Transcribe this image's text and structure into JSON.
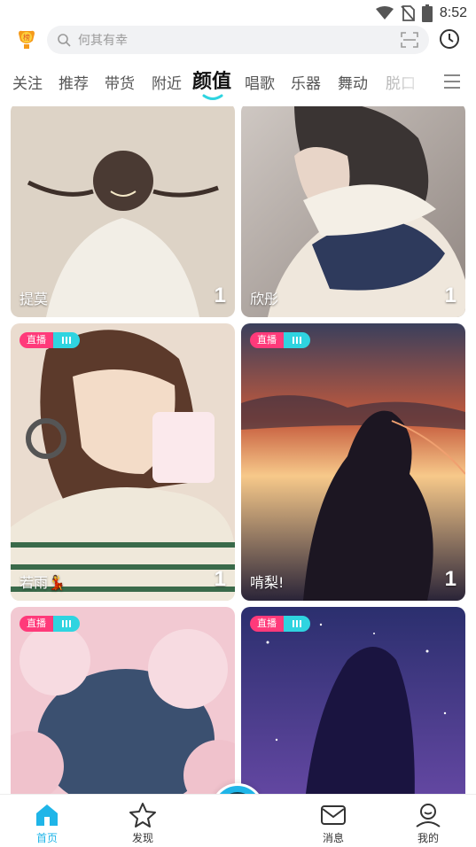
{
  "status_bar": {
    "time": "8:52",
    "icons": [
      "wifi-icon",
      "no-sim-icon",
      "battery-icon"
    ]
  },
  "header": {
    "logo_icon": "ranking-trophy-icon",
    "search": {
      "placeholder": "何其有幸",
      "icon": "search-icon",
      "scan_icon": "scan-icon"
    },
    "history_icon": "clock-icon"
  },
  "tabs": {
    "items": [
      {
        "label": "关注"
      },
      {
        "label": "推荐"
      },
      {
        "label": "带货"
      },
      {
        "label": "附近"
      },
      {
        "label": "颜值",
        "active": true
      },
      {
        "label": "唱歌"
      },
      {
        "label": "乐器"
      },
      {
        "label": "舞动"
      },
      {
        "label": "脱口"
      }
    ],
    "menu_icon": "menu-icon",
    "accent_color": "#2fd4e0"
  },
  "feed": {
    "live_badge_label": "直播",
    "cards": [
      {
        "name": "提莫",
        "count": "1",
        "live": false
      },
      {
        "name": "欣彤",
        "count": "1",
        "live": false
      },
      {
        "name": "若雨💃",
        "count": "1",
        "live": true
      },
      {
        "name": "啃梨!",
        "count": "1",
        "live": true
      },
      {
        "name": "",
        "count": "",
        "live": true
      },
      {
        "name": "",
        "count": "",
        "live": true
      }
    ],
    "badge_colors": {
      "live": "#ff3a7a",
      "bars": "#2fd4e0"
    }
  },
  "bottom_nav": {
    "items": [
      {
        "label": "首页",
        "icon": "home-icon",
        "active": true
      },
      {
        "label": "发现",
        "icon": "star-icon"
      },
      {
        "label": "",
        "icon": "camera-lens-icon"
      },
      {
        "label": "消息",
        "icon": "mail-icon"
      },
      {
        "label": "我的",
        "icon": "profile-icon"
      }
    ],
    "active_color": "#1fb5e8"
  }
}
